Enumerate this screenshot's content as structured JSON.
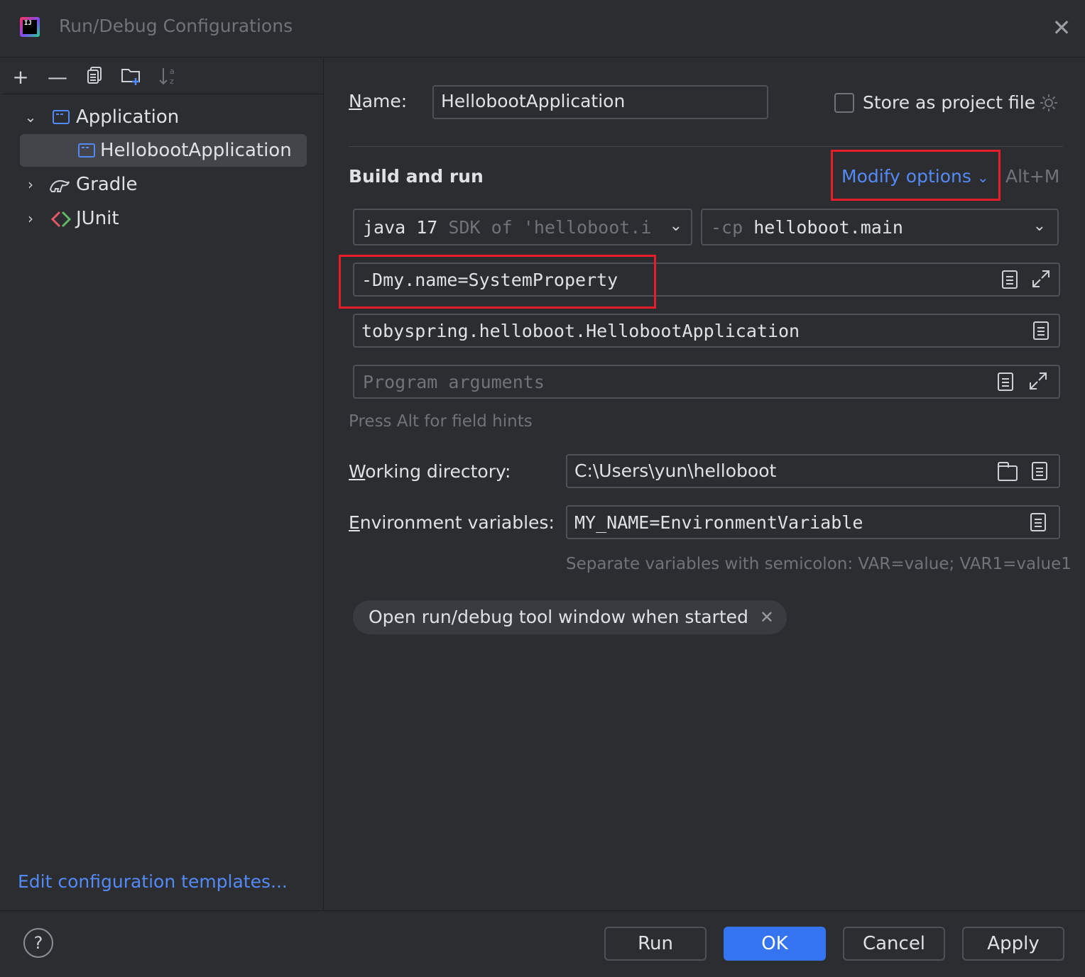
{
  "window": {
    "title": "Run/Debug Configurations"
  },
  "toolbar": {
    "add": "+",
    "remove": "—",
    "sort_hint": "a z"
  },
  "tree": {
    "application": "Application",
    "app_child": "HellobootApplication",
    "gradle": "Gradle",
    "junit": "JUnit"
  },
  "edit_templates": "Edit configuration templates...",
  "form": {
    "name_label_first": "N",
    "name_label_rest": "ame:",
    "name_value": "HellobootApplication",
    "store_label": "Store as project file",
    "build_and_run": "Build and run",
    "modify_options": "Modify options",
    "modify_shortcut": "Alt+M",
    "sdk_java": "java 17",
    "sdk_rest": "SDK of 'helloboot.i",
    "cp_prefix": "-cp",
    "cp_value": "helloboot.main",
    "vm_options": "-Dmy.name=SystemProperty",
    "main_class": "tobyspring.helloboot.HellobootApplication",
    "program_args_placeholder": "Program arguments",
    "field_hint": "Press Alt for field hints",
    "workdir_label_first": "W",
    "workdir_label_rest": "orking directory:",
    "workdir_value": "C:\\Users\\yun\\helloboot",
    "env_label_first": "E",
    "env_label_rest": "nvironment variables:",
    "env_value": "MY_NAME=EnvironmentVariable",
    "env_hint": "Separate variables with semicolon: VAR=value; VAR1=value1",
    "chip_label": "Open run/debug tool window when started"
  },
  "buttons": {
    "run": "Run",
    "ok": "OK",
    "cancel": "Cancel",
    "apply": "Apply",
    "help": "?"
  },
  "colors": {
    "accent": "#3574f0",
    "link": "#548af7",
    "highlight_box": "#e51e2a",
    "background": "#2b2d30"
  }
}
